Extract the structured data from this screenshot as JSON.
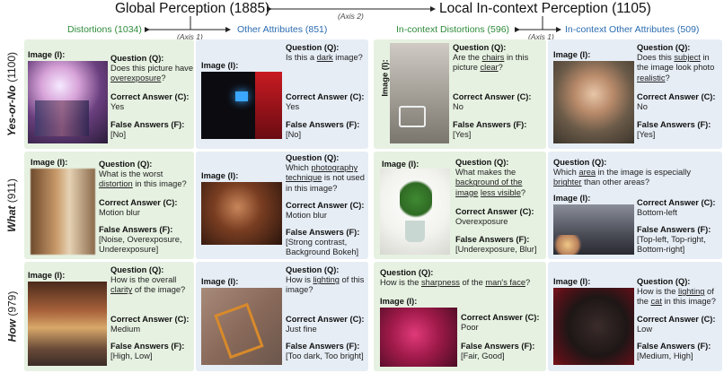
{
  "header": {
    "global": "Global Perception (1885)",
    "local": "Local In-context Perception (1105)",
    "axis2": "(Axis 2)",
    "axis1_left": "(Axis 1)",
    "axis1_right": "(Axis 1)",
    "cat_distortions": "Distortions (1034)",
    "cat_other": "Other Attributes (851)",
    "cat_ic_distortions": "In-context Distortions (596)",
    "cat_ic_other": "In-context Other Attributes (509)"
  },
  "rows": {
    "yesno_bold": "Yes-or-No",
    "yesno_count": " (1100)",
    "what_bold": "What",
    "what_count": " (911)",
    "how_bold": "How",
    "how_count": " (979)"
  },
  "labels": {
    "image": "Image (I):",
    "question": "Question (Q):",
    "correct": "Correct Answer (C):",
    "false": "False Answers (F):"
  },
  "cells": {
    "r1c1": {
      "q_pre": "Does this picture have ",
      "q_u": "overexposure",
      "q_post": "?",
      "c": "Yes",
      "f": "[No]"
    },
    "r1c2": {
      "q_pre": "Is this a ",
      "q_u": "dark",
      "q_post": " image?",
      "c": "Yes",
      "f": "[No]"
    },
    "r1c3": {
      "q_pre": "Are the ",
      "q_u": "chairs",
      "q_mid": " in this picture ",
      "q_u2": "clear",
      "q_post": "?",
      "c": "No",
      "f": "[Yes]"
    },
    "r1c4": {
      "q_pre": "Does this ",
      "q_u": "subject",
      "q_mid": " in the image look photo ",
      "q_u2": "realistic",
      "q_post": "?",
      "c": "No",
      "f": "[Yes]"
    },
    "r2c1": {
      "q_pre": "What is the worst ",
      "q_u": "distortion",
      "q_post": " in this image?",
      "c": "Motion blur",
      "f": "[Noise, Overexposure, Underexposure]"
    },
    "r2c2": {
      "q_pre": "Which ",
      "q_u": "photography technique",
      "q_post": " is not used in this image?",
      "c": "Motion blur",
      "f": "[Strong contrast, Background Bokeh]"
    },
    "r2c3": {
      "q_pre": "What makes the ",
      "q_u": "background of the image",
      "q_mid": " ",
      "q_u2": "less visible",
      "q_post": "?",
      "c": "Overexposure",
      "f": "[Underexposure, Blur]"
    },
    "r2c4": {
      "q_pre": "Which ",
      "q_u": "area",
      "q_mid": " in the image is especially ",
      "q_u2": "brighter",
      "q_post": " than other areas?",
      "c": "Bottom-left",
      "f": "[Top-left, Top-right, Bottom-right]"
    },
    "r3c1": {
      "q_pre": "How is the overall ",
      "q_u": "clarity",
      "q_post": " of the image?",
      "c": "Medium",
      "f": "[High, Low]"
    },
    "r3c2": {
      "q_pre": "How is ",
      "q_u": "lighting",
      "q_post": " of this image?",
      "c": "Just fine",
      "f": "[Too dark, Too bright]"
    },
    "r3c3": {
      "q_pre": "How is the ",
      "q_u": "sharpness",
      "q_mid": " of the ",
      "q_u2": "man's face",
      "q_post": "?",
      "c": "Poor",
      "f": "[Fair, Good]"
    },
    "r3c4": {
      "q_pre": "How is the ",
      "q_u": "lighting",
      "q_mid": " of the ",
      "q_u2": "cat",
      "q_post": " in this image?",
      "c": "Low",
      "f": "[Medium, High]"
    }
  },
  "colors": {
    "green_panel": "#e6f1e1",
    "blue_panel": "#e6edf5",
    "green_text": "#2e8b3a",
    "blue_text": "#2b6cb0"
  }
}
